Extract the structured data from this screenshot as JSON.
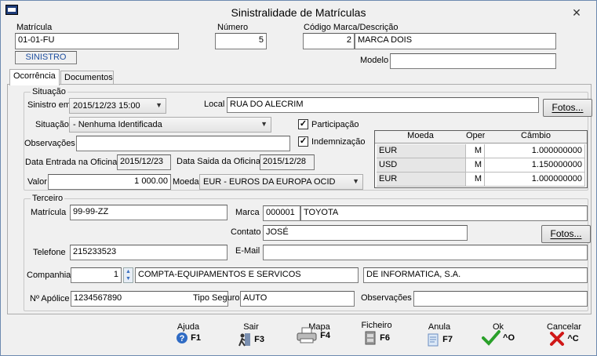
{
  "window": {
    "title": "Sinistralidade de Matrículas",
    "close_glyph": "✕"
  },
  "header": {
    "matricula_label": "Matrícula",
    "matricula_value": "01-01-FU",
    "status_badge": "SINISTRO",
    "numero_label": "Número",
    "numero_value": "5",
    "marca_label": "Código Marca/Descrição",
    "marca_code": "2",
    "marca_desc": "MARCA DOIS",
    "modelo_label": "Modelo",
    "modelo_value": ""
  },
  "tabs": [
    {
      "label": "Ocorrência",
      "active": true
    },
    {
      "label": "Documentos",
      "active": false
    }
  ],
  "situacao": {
    "group_title": "Situação",
    "sinistro_em_label": "Sinistro em",
    "sinistro_em_value": "2015/12/23 15:00",
    "local_label": "Local",
    "local_value": "RUA DO ALECRIM",
    "fotos_button": "Fotos...",
    "situacao_label": "Situação",
    "situacao_value": "- Nenhuma Identificada",
    "participacao_label": "Participação",
    "participacao_checked": true,
    "indemnizacao_label": "Indemnização",
    "indemnizacao_checked": true,
    "observacoes_label": "Observações",
    "observacoes_value": "",
    "data_entrada_label": "Data Entrada na Oficina",
    "data_entrada_value": "2015/12/23",
    "data_saida_label": "Data Saida da Oficina",
    "data_saida_value": "2015/12/28",
    "valor_label": "Valor",
    "valor_value": "1 000.00",
    "moeda_label": "Moeda",
    "moeda_value": "EUR - EUROS DA EUROPA OCID"
  },
  "currency_grid": {
    "headers": {
      "moeda": "Moeda",
      "oper": "Oper.",
      "cambio": "Câmbio"
    },
    "rows": [
      {
        "moeda": "EUR",
        "oper": "M",
        "cambio": "1.000000000"
      },
      {
        "moeda": "USD",
        "oper": "M",
        "cambio": "1.150000000"
      },
      {
        "moeda": "EUR",
        "oper": "M",
        "cambio": "1.000000000"
      }
    ]
  },
  "terceiro": {
    "group_title": "Terceiro",
    "matricula_label": "Matrícula",
    "matricula_value": "99-99-ZZ",
    "marca_label": "Marca",
    "marca_code": "000001",
    "marca_desc": "TOYOTA",
    "contato_label": "Contato",
    "contato_value": "JOSÉ",
    "fotos_button": "Fotos...",
    "telefone_label": "Telefone",
    "telefone_value": "215233523",
    "email_label": "E-Mail",
    "email_value": "",
    "companhia_label": "Companhia",
    "companhia_code": "1",
    "companhia_name": "COMPTA-EQUIPAMENTOS E SERVICOS",
    "companhia_name2": "DE INFORMATICA, S.A.",
    "apolice_label": "Nº Apólice",
    "apolice_value": "1234567890",
    "tipo_seguro_label": "Tipo Seguro",
    "tipo_seguro_value": "AUTO",
    "observacoes_label": "Observações",
    "observacoes_value": ""
  },
  "toolbar": {
    "ajuda": {
      "label": "Ajuda",
      "key": "F1",
      "icon": "help-icon"
    },
    "sair": {
      "label": "Sair",
      "key": "F3",
      "icon": "exit-icon"
    },
    "mapa": {
      "label": "Mapa",
      "key": "F4",
      "icon": "printer-icon"
    },
    "ficheiro": {
      "label": "Ficheiro",
      "key": "F6",
      "icon": "file-cabinet-icon"
    },
    "anula": {
      "label": "Anula",
      "key": "F7",
      "icon": "cancel-doc-icon"
    },
    "ok": {
      "label": "Ok",
      "key": "^O",
      "icon": "checkmark-icon"
    },
    "cancelar": {
      "label": "Cancelar",
      "key": "^C",
      "icon": "x-icon"
    }
  },
  "colors": {
    "accent_blue": "#1e4fa0",
    "ok_green": "#2aa02a",
    "cancel_red": "#d01818"
  }
}
